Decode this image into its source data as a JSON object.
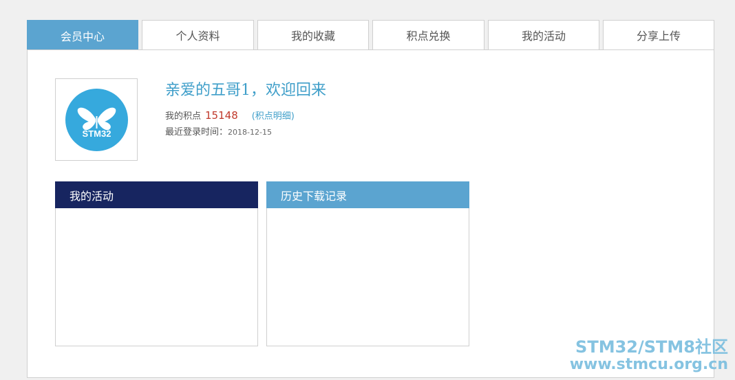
{
  "tabs": [
    {
      "label": "会员中心",
      "active": true
    },
    {
      "label": "个人资料",
      "active": false
    },
    {
      "label": "我的收藏",
      "active": false
    },
    {
      "label": "积点兑换",
      "active": false
    },
    {
      "label": "我的活动",
      "active": false
    },
    {
      "label": "分享上传",
      "active": false
    }
  ],
  "profile": {
    "avatar_text": "STM32",
    "avatar_icon": "butterfly-icon",
    "welcome": "亲爱的五哥1，欢迎回来",
    "points_label": "我的积点",
    "points_value": "15148",
    "points_detail_link": "(积点明细)",
    "last_login_label": "最近登录时间：",
    "last_login_date": "2018-12-15"
  },
  "boxes": {
    "activities_title": "我的活动",
    "downloads_title": "历史下载记录"
  },
  "watermark": {
    "line1": "STM32/STM8社区",
    "line2": "www.stmcu.org.cn"
  },
  "colors": {
    "accent": "#5ba4d0",
    "dark_header": "#172560",
    "points": "#c0392b",
    "link": "#3e9ec9"
  }
}
